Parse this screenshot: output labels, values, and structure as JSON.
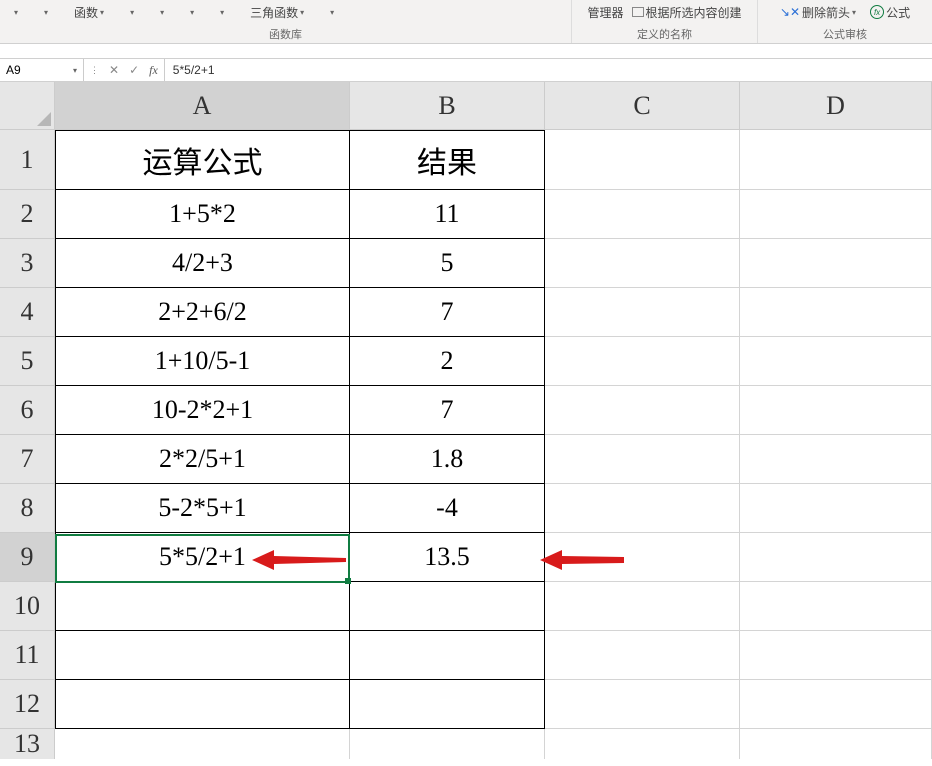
{
  "ribbon": {
    "item_fn": "函数",
    "item_trig": "三角函数",
    "group_fn_lib": "函数库",
    "item_manager": "管理器",
    "item_create_from_selection": "根据所选内容创建",
    "group_names": "定义的名称",
    "item_remove_arrows": "删除箭头",
    "item_formula": "公式",
    "group_audit": "公式审核"
  },
  "formula_bar": {
    "name_box": "A9",
    "formula": "5*5/2+1"
  },
  "columns": [
    "A",
    "B",
    "C",
    "D"
  ],
  "rows": [
    "1",
    "2",
    "3",
    "4",
    "5",
    "6",
    "7",
    "8",
    "9",
    "10",
    "11",
    "12",
    "13"
  ],
  "cells": {
    "A1": "运算公式",
    "B1": "结果",
    "A2": "1+5*2",
    "B2": "11",
    "A3": "4/2+3",
    "B3": "5",
    "A4": "2+2+6/2",
    "B4": "7",
    "A5": "1+10/5-1",
    "B5": "2",
    "A6": "10-2*2+1",
    "B6": "7",
    "A7": "2*2/5+1",
    "B7": "1.8",
    "A8": "5-2*5+1",
    "B8": "-4",
    "A9": "5*5/2+1",
    "B9": "13.5"
  },
  "chart_data": {
    "type": "table",
    "title": "运算公式 / 结果",
    "columns": [
      "运算公式",
      "结果"
    ],
    "rows": [
      {
        "expr": "1+5*2",
        "result": 11
      },
      {
        "expr": "4/2+3",
        "result": 5
      },
      {
        "expr": "2+2+6/2",
        "result": 7
      },
      {
        "expr": "1+10/5-1",
        "result": 2
      },
      {
        "expr": "10-2*2+1",
        "result": 7
      },
      {
        "expr": "2*2/5+1",
        "result": 1.8
      },
      {
        "expr": "5-2*5+1",
        "result": -4
      },
      {
        "expr": "5*5/2+1",
        "result": 13.5
      }
    ]
  },
  "active_cell": "A9",
  "arrow_color": "#d81b1b"
}
